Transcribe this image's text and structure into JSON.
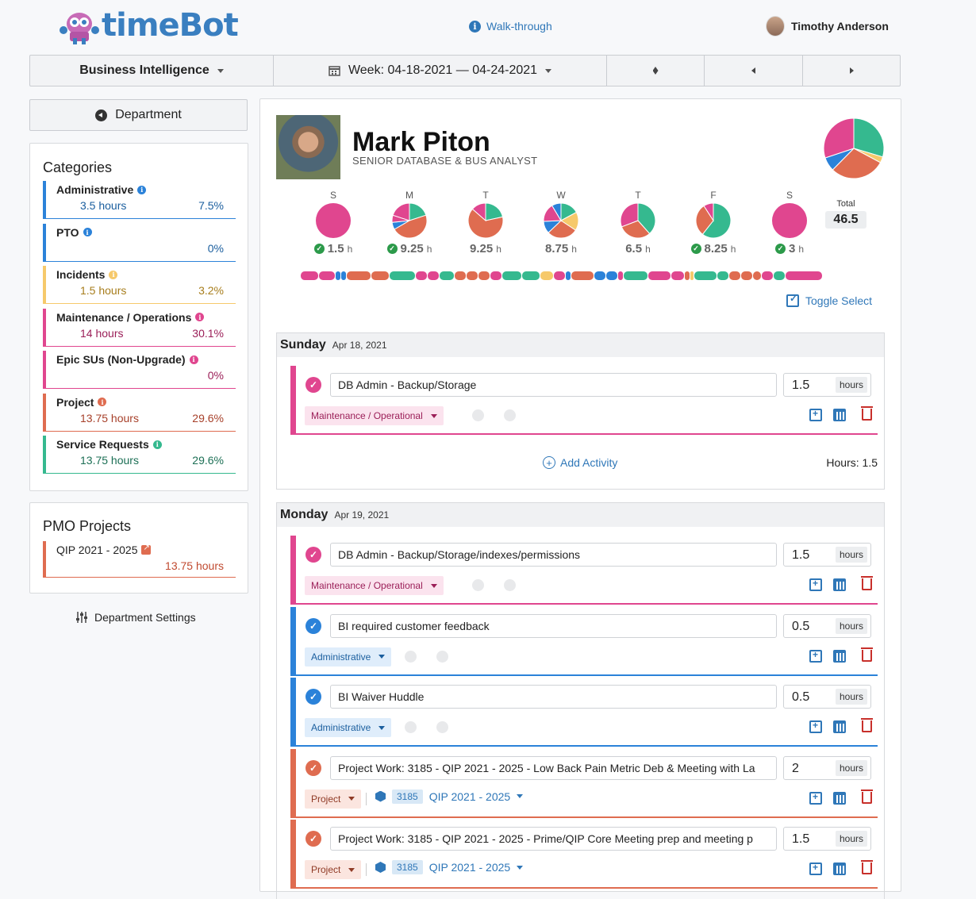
{
  "header": {
    "logo_text": "timeBot",
    "walkthrough": "Walk-through",
    "user_name": "Timothy Anderson"
  },
  "toolbar": {
    "department": "Business Intelligence",
    "week": "Week: 04-18-2021 — 04-24-2021"
  },
  "sidebar": {
    "back_label": "Department",
    "categories_title": "Categories",
    "categories": [
      {
        "name": "Administrative",
        "hours": "3.5 hours",
        "pct": "7.5%",
        "color": "#2b82d9"
      },
      {
        "name": "PTO",
        "hours": "",
        "pct": "0%",
        "color": "#2b82d9"
      },
      {
        "name": "Incidents",
        "hours": "1.5 hours",
        "pct": "3.2%",
        "color": "#f6c96b"
      },
      {
        "name": "Maintenance / Operations",
        "hours": "14 hours",
        "pct": "30.1%",
        "color": "#e0468f"
      },
      {
        "name": "Epic SUs (Non-Upgrade)",
        "hours": "",
        "pct": "0%",
        "color": "#e0468f"
      },
      {
        "name": "Project",
        "hours": "13.75 hours",
        "pct": "29.6%",
        "color": "#df6c50"
      },
      {
        "name": "Service Requests",
        "hours": "13.75 hours",
        "pct": "29.6%",
        "color": "#35b98f"
      }
    ],
    "pmo_title": "PMO Projects",
    "pmo_project": "QIP 2021 - 2025",
    "pmo_hours": "13.75 hours",
    "settings_label": "Department Settings"
  },
  "employee": {
    "name": "Mark Piton",
    "title": "SENIOR DATABASE & BUS ANALYST",
    "total_label": "Total",
    "total": "46.5",
    "summary_pie": [
      30.1,
      29.6,
      29.6,
      7.5,
      3.2
    ]
  },
  "days": [
    {
      "letter": "S",
      "hours": "1.5",
      "unit": "h",
      "checked": true
    },
    {
      "letter": "M",
      "hours": "9.25",
      "unit": "h",
      "checked": true
    },
    {
      "letter": "T",
      "hours": "9.25",
      "unit": "h",
      "checked": false
    },
    {
      "letter": "W",
      "hours": "8.75",
      "unit": "h",
      "checked": false
    },
    {
      "letter": "T",
      "hours": "6.5",
      "unit": "h",
      "checked": false
    },
    {
      "letter": "F",
      "hours": "8.25",
      "unit": "h",
      "checked": true
    },
    {
      "letter": "S",
      "hours": "3",
      "unit": "h",
      "checked": true
    }
  ],
  "colors": {
    "maint": "#e0468f",
    "admin": "#2b82d9",
    "incident": "#f6c96b",
    "project": "#df6c50",
    "service": "#35b98f",
    "accent": "#2f77b8"
  },
  "toggle_select": "Toggle Select",
  "sunday": {
    "day": "Sunday",
    "date": "Apr 18, 2021",
    "activities": [
      {
        "text": "DB Admin - Backup/Storage",
        "hours": "1.5",
        "unit": "hours",
        "category": "Maintenance / Operational"
      }
    ],
    "add_activity": "Add Activity",
    "hours_total": "Hours: 1.5"
  },
  "monday": {
    "day": "Monday",
    "date": "Apr 19, 2021",
    "activities": [
      {
        "text": "DB Admin - Backup/Storage/indexes/permissions",
        "hours": "1.5",
        "unit": "hours",
        "category": "Maintenance / Operational"
      },
      {
        "text": "BI required customer feedback",
        "hours": "0.5",
        "unit": "hours",
        "category": "Administrative"
      },
      {
        "text": "BI Waiver Huddle",
        "hours": "0.5",
        "unit": "hours",
        "category": "Administrative"
      },
      {
        "text": "Project Work: 3185 - QIP 2021 - 2025 - Low Back Pain Metric Deb & Meeting with La",
        "hours": "2",
        "unit": "hours",
        "category": "Project",
        "project_id": "3185",
        "project_name": "QIP 2021 - 2025"
      },
      {
        "text": "Project Work: 3185 - QIP 2021 - 2025 - Prime/QIP Core Meeting prep and meeting p",
        "hours": "1.5",
        "unit": "hours",
        "category": "Project",
        "project_id": "3185",
        "project_name": "QIP 2021 - 2025"
      }
    ]
  }
}
